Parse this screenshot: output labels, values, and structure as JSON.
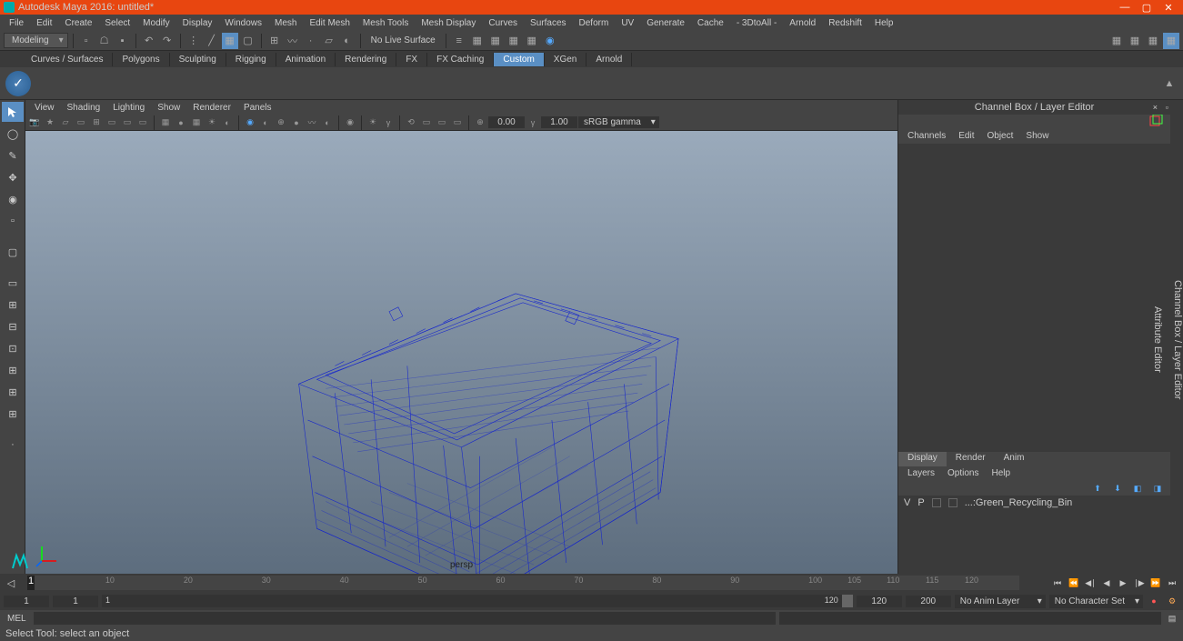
{
  "titlebar": {
    "title": "Autodesk Maya 2016: untitled*"
  },
  "menubar": [
    "File",
    "Edit",
    "Create",
    "Select",
    "Modify",
    "Display",
    "Windows",
    "Mesh",
    "Edit Mesh",
    "Mesh Tools",
    "Mesh Display",
    "Curves",
    "Surfaces",
    "Deform",
    "UV",
    "Generate",
    "Cache",
    "- 3DtoAll -",
    "Arnold",
    "Redshift",
    "Help"
  ],
  "workspace": "Modeling",
  "live_surface": "No Live Surface",
  "shelf_tabs": [
    "Curves / Surfaces",
    "Polygons",
    "Sculpting",
    "Rigging",
    "Animation",
    "Rendering",
    "FX",
    "FX Caching",
    "Custom",
    "XGen",
    "Arnold"
  ],
  "shelf_active": "Custom",
  "viewport_menus": [
    "View",
    "Shading",
    "Lighting",
    "Show",
    "Renderer",
    "Panels"
  ],
  "vp_num1": "0.00",
  "vp_num2": "1.00",
  "vp_colorspace": "sRGB gamma",
  "vp_camera": "persp",
  "channel_box": {
    "title": "Channel Box / Layer Editor",
    "menus": [
      "Channels",
      "Edit",
      "Object",
      "Show"
    ],
    "tabs": [
      "Display",
      "Render",
      "Anim"
    ],
    "tab_active": "Display",
    "tabs2": [
      "Layers",
      "Options",
      "Help"
    ],
    "layer": {
      "v": "V",
      "p": "P",
      "name": "...:Green_Recycling_Bin"
    }
  },
  "right_strip": [
    "Channel Box / Layer Editor",
    "Attribute Editor"
  ],
  "timeline": {
    "ticks": [
      10,
      20,
      30,
      40,
      50,
      60,
      70,
      80,
      90,
      100,
      105,
      110,
      115,
      120
    ],
    "start_outer": "1",
    "start_inner": "1",
    "slider_start": "1",
    "slider_end": "120",
    "end_inner": "120",
    "end_outer": "200",
    "anim_layer": "No Anim Layer",
    "char_set": "No Character Set"
  },
  "cmd": {
    "label": "MEL"
  },
  "status": "Select Tool: select an object"
}
